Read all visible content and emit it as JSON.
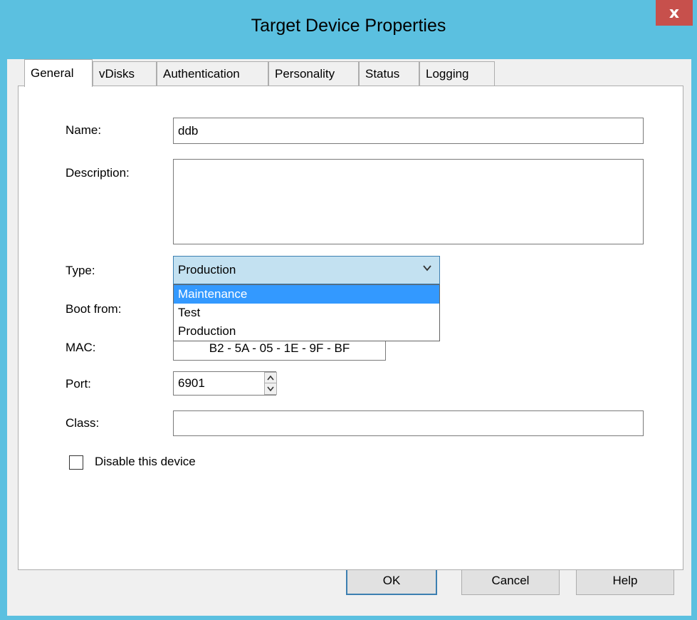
{
  "window": {
    "title": "Target Device Properties",
    "close_label": "x"
  },
  "tabs": [
    {
      "label": "General",
      "active": true
    },
    {
      "label": "vDisks",
      "active": false
    },
    {
      "label": "Authentication",
      "active": false
    },
    {
      "label": "Personality",
      "active": false
    },
    {
      "label": "Status",
      "active": false
    },
    {
      "label": "Logging",
      "active": false
    }
  ],
  "form": {
    "name_label": "Name:",
    "name_value": "ddb",
    "description_label": "Description:",
    "description_value": "",
    "type_label": "Type:",
    "type_value": "Production",
    "type_options": [
      "Maintenance",
      "Test",
      "Production"
    ],
    "type_highlighted": "Maintenance",
    "boot_label": "Boot from:",
    "mac_label": "MAC:",
    "mac_value": "B2 - 5A - 05 - 1E - 9F - BF",
    "port_label": "Port:",
    "port_value": "6901",
    "class_label": "Class:",
    "class_value": "",
    "disable_label": "Disable this device",
    "disable_checked": false
  },
  "buttons": {
    "ok": "OK",
    "cancel": "Cancel",
    "help": "Help"
  },
  "colors": {
    "titlebar": "#5bc0e0",
    "close": "#c7504c",
    "highlight": "#3399ff",
    "combo_focus": "#c3e1f1"
  }
}
